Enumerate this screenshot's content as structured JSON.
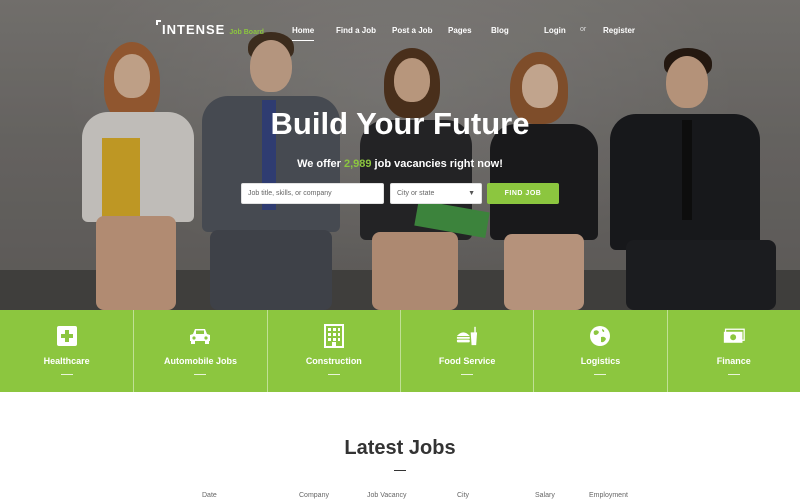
{
  "brand": {
    "name": "INTENSE",
    "tagline": "Job Board"
  },
  "nav": {
    "items": [
      {
        "label": "Home",
        "active": true
      },
      {
        "label": "Find a Job",
        "active": false
      },
      {
        "label": "Post a Job",
        "active": false
      },
      {
        "label": "Pages",
        "active": false
      },
      {
        "label": "Blog",
        "active": false
      }
    ],
    "login": "Login",
    "or": "or",
    "register": "Register"
  },
  "hero": {
    "title": "Build Your Future",
    "subtitle_before": "We offer",
    "vacancy_count": "2,989",
    "subtitle_after": "job vacancies right now!"
  },
  "search": {
    "keyword_placeholder": "Job title, skills, or company",
    "location_selected": "City or state",
    "button_label": "FIND JOB"
  },
  "categories": [
    {
      "label": "Healthcare",
      "icon": "medical-cross-icon"
    },
    {
      "label": "Automobile Jobs",
      "icon": "car-icon"
    },
    {
      "label": "Construction",
      "icon": "building-icon"
    },
    {
      "label": "Food Service",
      "icon": "burger-drink-icon"
    },
    {
      "label": "Logistics",
      "icon": "globe-icon"
    },
    {
      "label": "Finance",
      "icon": "money-icon"
    }
  ],
  "latest_jobs": {
    "title": "Latest Jobs",
    "columns": [
      "Date",
      "Company",
      "Job Vacancy",
      "City",
      "Salary",
      "Employment"
    ]
  },
  "colors": {
    "accent": "#8cc63f",
    "text_dark": "#333333",
    "white": "#ffffff"
  }
}
